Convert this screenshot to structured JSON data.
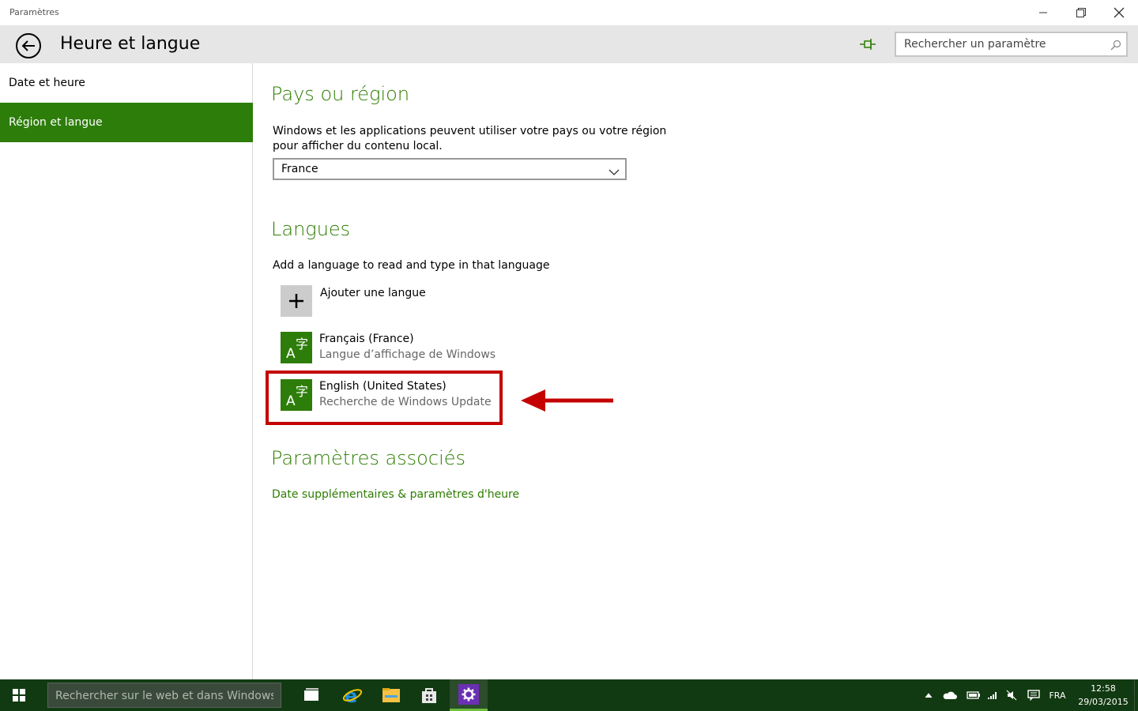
{
  "window": {
    "title": "Paramètres"
  },
  "header": {
    "title": "Heure et langue",
    "search_placeholder": "Rechercher un paramètre"
  },
  "sidebar": {
    "items": [
      {
        "label": "Date et heure"
      },
      {
        "label": "Région et langue",
        "selected": true
      }
    ]
  },
  "region": {
    "title": "Pays ou région",
    "description_line1": "Windows et les applications peuvent utiliser votre pays ou votre région",
    "description_line2": "pour afficher du contenu local.",
    "selected_country": "France"
  },
  "languages": {
    "title": "Langues",
    "description": "Add a language to read and type in that language",
    "add_label": "Ajouter une langue",
    "items": [
      {
        "name": "Français (France)",
        "status": "Langue d’affichage de Windows"
      },
      {
        "name": "English (United States)",
        "status": "Recherche de Windows Update"
      }
    ]
  },
  "related": {
    "title": "Paramètres associés",
    "link": "Date supplémentaires & paramètres d'heure"
  },
  "taskbar": {
    "search_placeholder": "Rechercher sur le web et dans Windows",
    "lang": "FRA",
    "time": "12:58",
    "date": "29/03/2015"
  },
  "colors": {
    "accent": "#2d7d0a",
    "highlight": "#c40000",
    "taskbar": "#123a12"
  }
}
